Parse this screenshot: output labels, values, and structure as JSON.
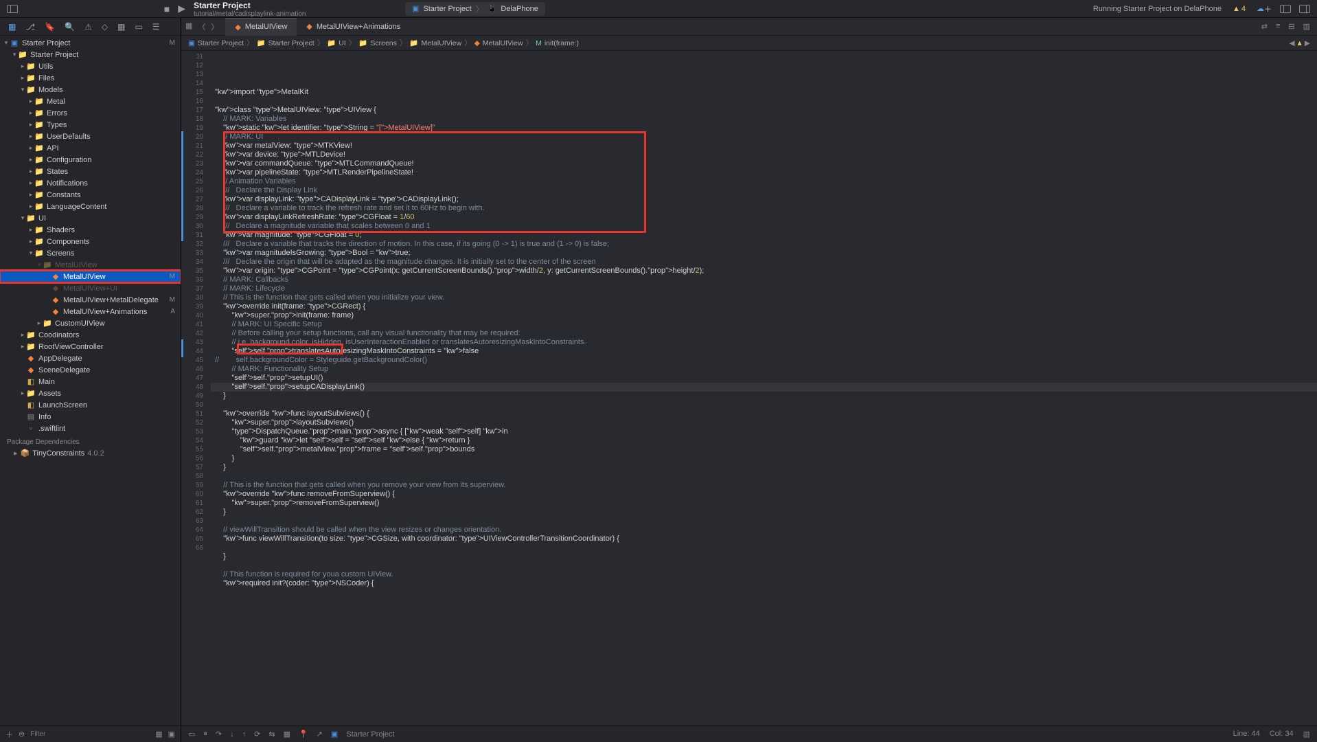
{
  "titlebar": {
    "project_name": "Starter Project",
    "subtitle": "tutorial/metal/cadisplaylink-animation",
    "scheme": "Starter Project",
    "device": "DelaPhone",
    "status": "Running Starter Project on DelaPhone",
    "warnings": "4"
  },
  "tabs": {
    "active": "MetalUIView",
    "second": "MetalUIView+Animations"
  },
  "jumpbar": {
    "items": [
      "Starter Project",
      "Starter Project",
      "UI",
      "Screens",
      "MetalUIView",
      "MetalUIView",
      "init(frame:)"
    ]
  },
  "tree": {
    "root": "Starter Project",
    "root_status": "M",
    "starter": "Starter Project",
    "items": [
      {
        "l": "Utils",
        "i": 2,
        "f": true
      },
      {
        "l": "Files",
        "i": 2,
        "f": true
      },
      {
        "l": "Models",
        "i": 2,
        "f": true,
        "open": true
      },
      {
        "l": "Metal",
        "i": 3,
        "f": true
      },
      {
        "l": "Errors",
        "i": 3,
        "f": true
      },
      {
        "l": "Types",
        "i": 3,
        "f": true
      },
      {
        "l": "UserDefaults",
        "i": 3,
        "f": true
      },
      {
        "l": "API",
        "i": 3,
        "f": true
      },
      {
        "l": "Configuration",
        "i": 3,
        "f": true
      },
      {
        "l": "States",
        "i": 3,
        "f": true
      },
      {
        "l": "Notifications",
        "i": 3,
        "f": true
      },
      {
        "l": "Constants",
        "i": 3,
        "f": true
      },
      {
        "l": "LanguageContent",
        "i": 3,
        "f": true
      },
      {
        "l": "UI",
        "i": 2,
        "f": true,
        "open": true
      },
      {
        "l": "Shaders",
        "i": 3,
        "f": true
      },
      {
        "l": "Components",
        "i": 3,
        "f": true
      },
      {
        "l": "Screens",
        "i": 3,
        "f": true,
        "open": true
      },
      {
        "l": "MetalUIView",
        "i": 4,
        "f": true,
        "open": true,
        "obscured": true
      },
      {
        "l": "MetalUIView",
        "i": 5,
        "swift": true,
        "selected": true,
        "s": "M"
      },
      {
        "l": "MetalUIView+UI",
        "i": 5,
        "swift": true,
        "obscured": true
      },
      {
        "l": "MetalUIView+MetalDelegate",
        "i": 5,
        "swift": true,
        "s": "M"
      },
      {
        "l": "MetalUIView+Animations",
        "i": 5,
        "swift": true,
        "s": "A"
      },
      {
        "l": "CustomUIView",
        "i": 4,
        "f": true
      },
      {
        "l": "Coodinators",
        "i": 2,
        "f": true
      },
      {
        "l": "RootViewController",
        "i": 2,
        "f": true
      },
      {
        "l": "AppDelegate",
        "i": 2,
        "swift": true
      },
      {
        "l": "SceneDelegate",
        "i": 2,
        "swift": true
      },
      {
        "l": "Main",
        "i": 2,
        "yellow": true
      },
      {
        "l": "Assets",
        "i": 2,
        "f": true
      },
      {
        "l": "LaunchScreen",
        "i": 2,
        "yellow": true
      },
      {
        "l": "Info",
        "i": 2,
        "plist": true
      },
      {
        "l": ".swiftlint",
        "i": 2,
        "plain": true
      }
    ],
    "pkg_header": "Package Dependencies",
    "pkg_name": "TinyConstraints",
    "pkg_ver": "4.0.2"
  },
  "filter": {
    "placeholder": "Filter"
  },
  "code": {
    "first_line": 11,
    "lines": [
      "import MetalKit",
      "",
      "class MetalUIView: UIView {",
      "    // MARK: Variables",
      "    static let identifier: String = \"[MetalUIView]\"",
      "    // MARK: UI",
      "    var metalView: MTKView!",
      "    var device: MTLDevice!",
      "    var commandQueue: MTLCommandQueue!",
      "    var pipelineState: MTLRenderPipelineState!",
      "    // Animation Variables",
      "    ///   Declare the Display Link",
      "    var displayLink: CADisplayLink = CADisplayLink();",
      "    ///   Declare a variable to track the refresh rate and set it to 60Hz to begin with.",
      "    var displayLinkRefreshRate: CGFloat = 1/60",
      "    ///   Declare a magnitude variable that scales between 0 and 1",
      "    var magnitude: CGFloat = 0;",
      "    ///   Declare a variable that tracks the direction of motion. In this case, if its going (0 -> 1) is true and (1 -> 0) is false;",
      "    var magnitudeIsGrowing: Bool = true;",
      "    ///   Declare the origin that will be adapted as the magnitude changes. It is initially set to the center of the screen",
      "    var origin: CGPoint = CGPoint(x: getCurrentScreenBounds().width/2, y: getCurrentScreenBounds().height/2);",
      "    // MARK: Callbacks",
      "    // MARK: Lifecycle",
      "    // This is the function that gets called when you initialize your view.",
      "    override init(frame: CGRect) {",
      "        super.init(frame: frame)",
      "        // MARK: UI Specific Setup",
      "        // Before calling your setup functions, call any visual functionality that may be required:",
      "        // i.e. background color, isHidden, isUserInteractionEnabled or translatesAutoresizingMaskIntoConstraints.",
      "        self.translatesAutoresizingMaskIntoConstraints = false",
      "//        self.backgroundColor = Styleguide.getBackgroundColor()",
      "        // MARK: Functionality Setup",
      "        self.setupUI()",
      "        self.setupCADisplayLink()",
      "    }",
      "",
      "    override func layoutSubviews() {",
      "        super.layoutSubviews()",
      "        DispatchQueue.main.async { [weak self] in",
      "            guard let self = self else { return }",
      "            self.metalView.frame = self.bounds",
      "        }",
      "    }",
      "",
      "    // This is the function that gets called when you remove your view from its superview.",
      "    override func removeFromSuperview() {",
      "        super.removeFromSuperview()",
      "    }",
      "",
      "    // viewWillTransition should be called when the view resizes or changes orientation.",
      "    func viewWillTransition(to size: CGSize, with coordinator: UIViewControllerTransitionCoordinator) {",
      "",
      "    }",
      "",
      "    // This function is required for youa custom UIView.",
      "    required init?(coder: NSCoder) {"
    ]
  },
  "debug": {
    "scheme": "Starter Project",
    "line": "Line: 44",
    "col": "Col: 34"
  }
}
